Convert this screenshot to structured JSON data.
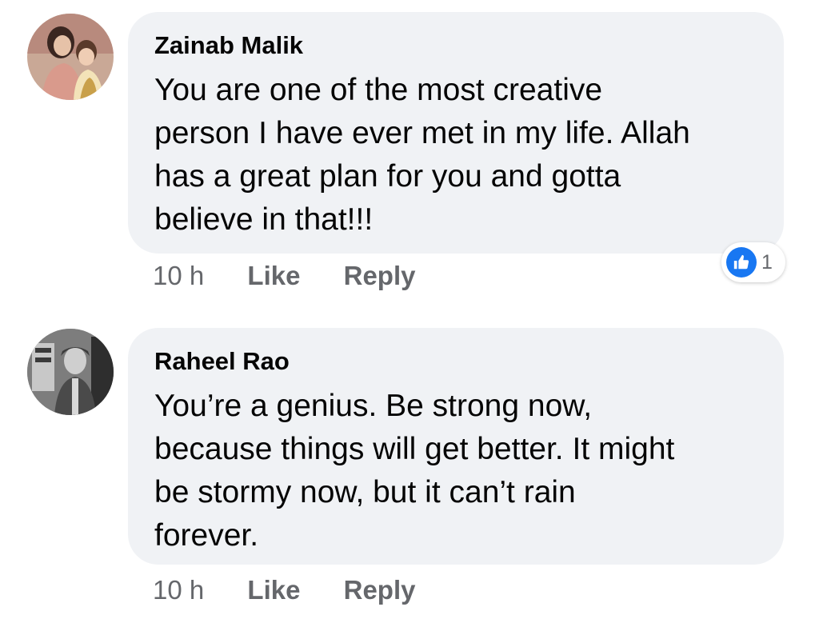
{
  "comments": [
    {
      "author": "Zainab Malik",
      "lines": [
        "You are one of the most creative",
        "person I have ever met in my life. Allah",
        "has a great plan for you and gotta",
        "believe in that!!!"
      ],
      "time": "10 h",
      "like_label": "Like",
      "reply_label": "Reply",
      "reaction_count": "1",
      "reaction_icon": "thumbs-up-icon",
      "reaction_color": "#1877f2"
    },
    {
      "author": "Raheel Rao",
      "lines": [
        "You’re a genius. Be strong now,",
        "because things will get better. It might",
        "be stormy now, but it can’t rain",
        "forever."
      ],
      "time": "10 h",
      "like_label": "Like",
      "reply_label": "Reply"
    }
  ],
  "colors": {
    "bubble_background": "#f0f2f5",
    "meta_text": "#65676b",
    "body_text": "#050505"
  }
}
